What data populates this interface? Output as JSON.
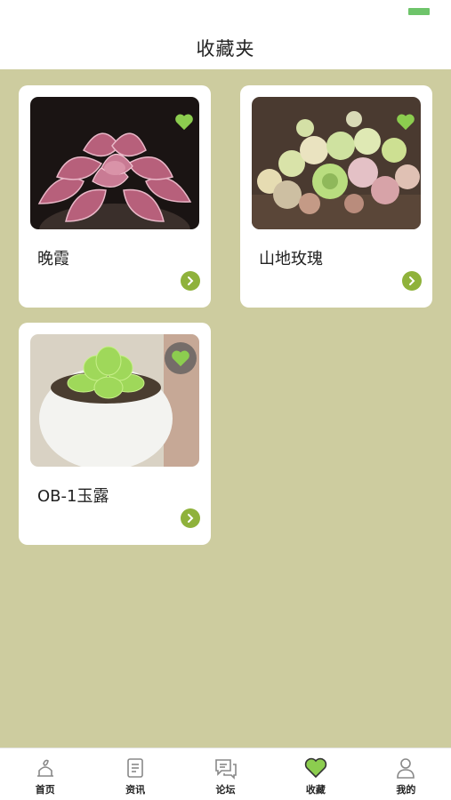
{
  "header": {
    "title": "收藏夹"
  },
  "cards": [
    {
      "title": "晚霞"
    },
    {
      "title": "山地玫瑰"
    },
    {
      "title": "OB-1玉露"
    }
  ],
  "tabs": [
    {
      "label": "首页",
      "icon": "home-icon"
    },
    {
      "label": "资讯",
      "icon": "news-icon"
    },
    {
      "label": "论坛",
      "icon": "forum-icon"
    },
    {
      "label": "收藏",
      "icon": "heart-icon",
      "active": true
    },
    {
      "label": "我的",
      "icon": "profile-icon"
    }
  ],
  "colors": {
    "background": "#cdcc9f",
    "accent_green": "#8fb23b",
    "heart_green": "#8ccd4f",
    "status_battery": "#6ec46a"
  }
}
